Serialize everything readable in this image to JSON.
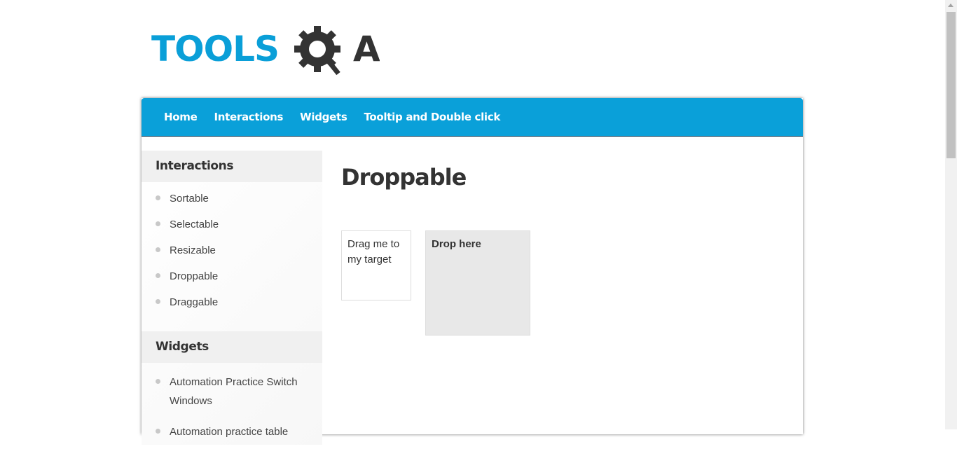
{
  "logo": {
    "text_left": "TOOLS",
    "text_right": "A",
    "alt": "TOOLSQA"
  },
  "nav": {
    "items": [
      "Home",
      "Interactions",
      "Widgets",
      "Tooltip and Double click"
    ]
  },
  "sidebar": {
    "interactions_title": "Interactions",
    "interactions_items": [
      "Sortable",
      "Selectable",
      "Resizable",
      "Droppable",
      "Draggable"
    ],
    "widgets_title": "Widgets",
    "widgets_items": [
      "Automation Practice Switch Windows",
      "Automation practice table"
    ]
  },
  "main": {
    "title": "Droppable",
    "draggable_text": "Drag me to my target",
    "droppable_text": "Drop here"
  },
  "colors": {
    "accent": "#0aa0d9",
    "logo_blue": "#0a9fd8",
    "logo_gray": "#333333",
    "drop_bg": "#e8e8e8"
  }
}
